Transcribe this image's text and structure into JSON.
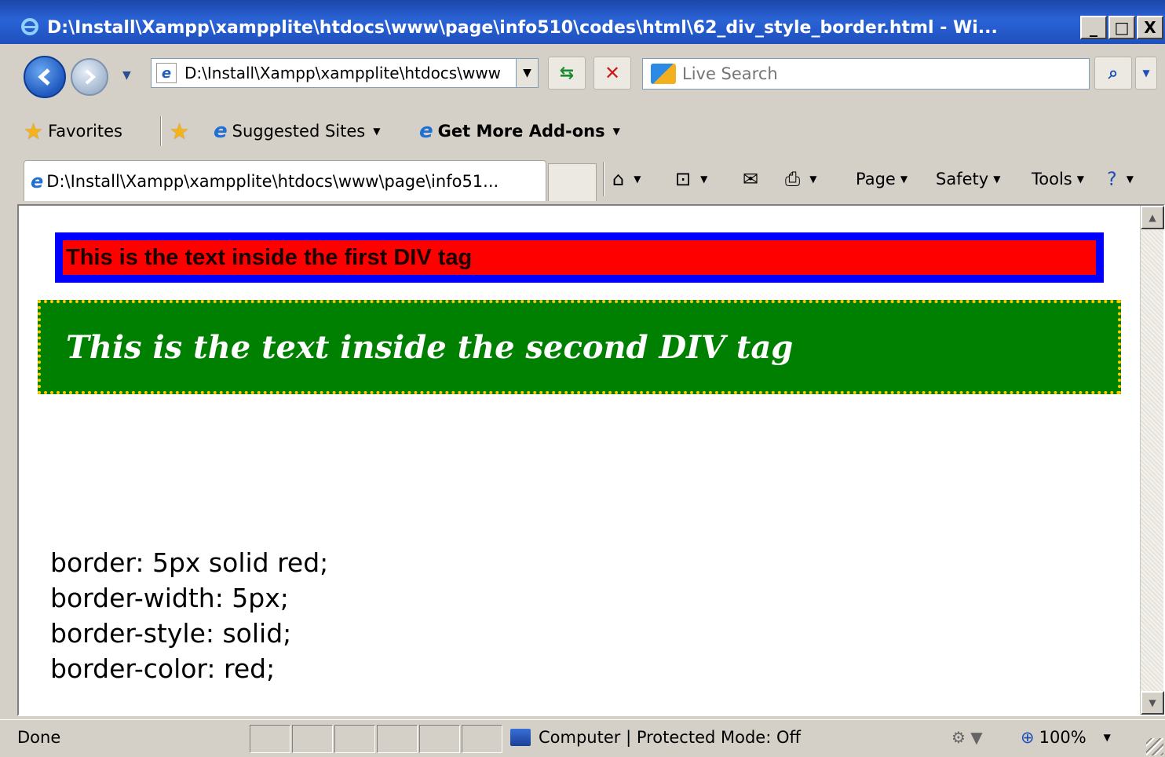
{
  "window": {
    "title": "D:\\Install\\Xampp\\xampplite\\htdocs\\www\\page\\info510\\codes\\html\\62_div_style_border.html - Wi...",
    "minimize": "_",
    "maximize": "□",
    "close": "X"
  },
  "address_bar": {
    "url": "D:\\Install\\Xampp\\xampplite\\htdocs\\www",
    "search_placeholder": "Live Search"
  },
  "favorites_bar": {
    "favorites_label": "Favorites",
    "suggested_sites_label": "Suggested Sites",
    "get_more_addons_label": "Get More Add-ons"
  },
  "tab": {
    "title": "D:\\Install\\Xampp\\xampplite\\htdocs\\www\\page\\info51..."
  },
  "command_bar": {
    "page_label": "Page",
    "safety_label": "Safety",
    "tools_label": "Tools"
  },
  "content": {
    "first_div_text": "This is the text inside the first DIV tag",
    "second_div_text": "This is the text inside the second DIV tag",
    "notes": [
      "border: 5px solid red;",
      "border-width: 5px;",
      "border-style: solid;",
      "border-color: red;"
    ],
    "colors": {
      "first_div_border": "#0000ff",
      "first_div_background": "#ff0000",
      "second_div_background": "#008000",
      "second_div_border": "#ffcc00"
    }
  },
  "status_bar": {
    "status": "Done",
    "zone": "Computer | Protected Mode: Off",
    "zoom": "100%"
  },
  "icons": [
    "ie-logo-icon",
    "back-arrow-icon",
    "forward-arrow-icon",
    "refresh-icon",
    "stop-icon",
    "search-icon",
    "star-icon",
    "add-favorite-icon",
    "home-icon",
    "rss-feed-icon",
    "mail-icon",
    "print-icon",
    "help-icon",
    "computer-zone-icon",
    "zoom-icon"
  ]
}
